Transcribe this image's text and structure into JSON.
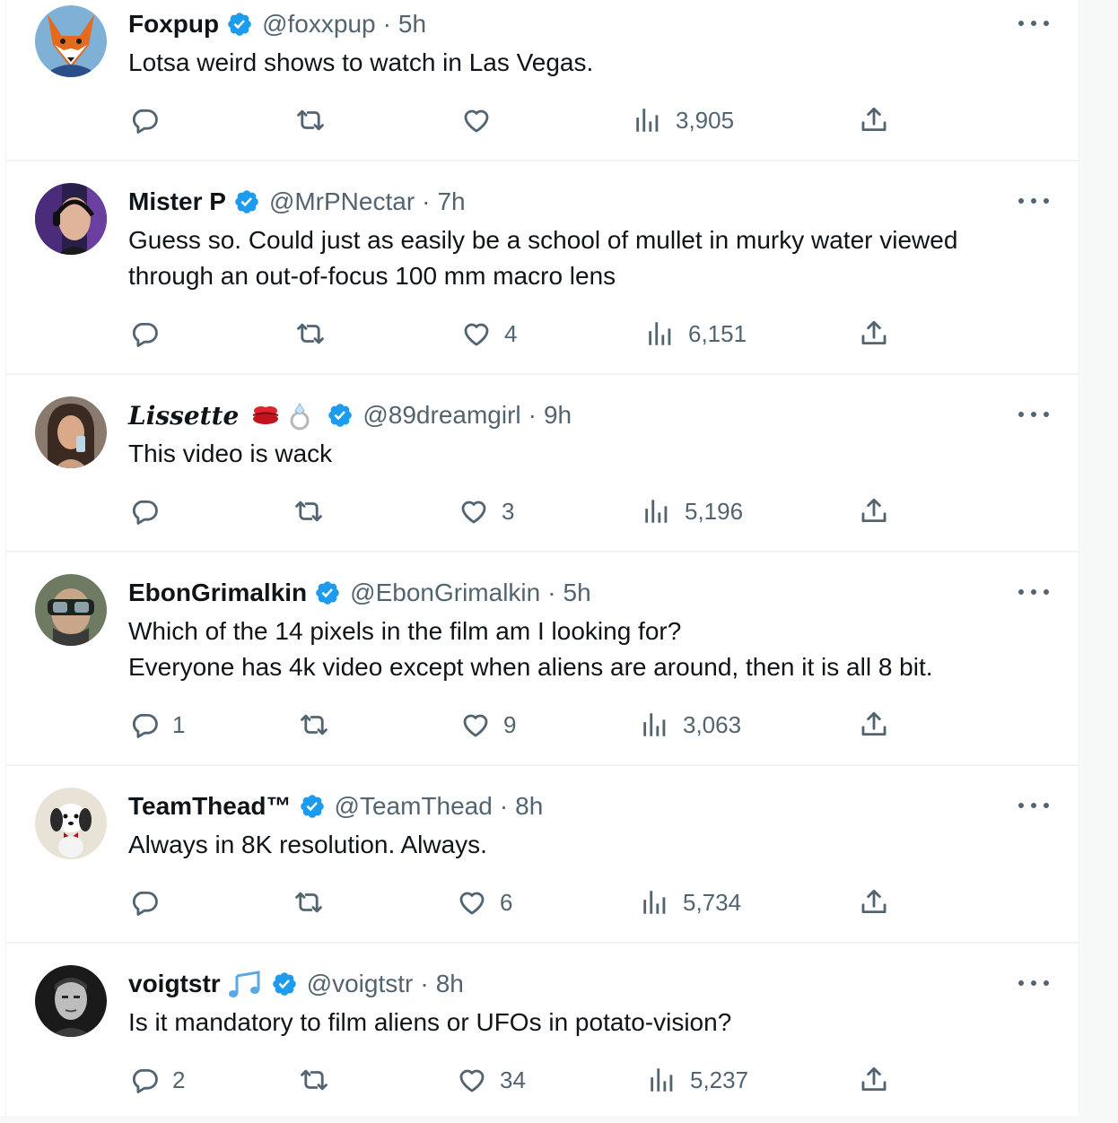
{
  "tweets": [
    {
      "name": "Foxpup",
      "name_emoji": "",
      "avatar": "fox-avatar",
      "verified": true,
      "handle": "@foxxpup",
      "separator": "·",
      "time": "5h",
      "text": [
        "Lotsa weird shows to watch in Las Vegas."
      ],
      "replies": "",
      "retweets": "",
      "likes": "",
      "views": "3,905"
    },
    {
      "name": "Mister P",
      "name_emoji": "",
      "avatar": "headphones-man-avatar",
      "verified": true,
      "handle": "@MrPNectar",
      "separator": "·",
      "time": "7h",
      "text": [
        "Guess so. Could just as easily be a school of mullet in murky water viewed",
        "through an out-of-focus 100 mm macro lens"
      ],
      "replies": "",
      "retweets": "",
      "likes": "4",
      "views": "6,151"
    },
    {
      "name": "Lissette",
      "name_emoji": "💋💍",
      "avatar": "woman-avatar",
      "verified": true,
      "handle": "@89dreamgirl",
      "separator": "·",
      "time": "9h",
      "text": [
        "This video is wack"
      ],
      "replies": "",
      "retweets": "",
      "likes": "3",
      "views": "5,196"
    },
    {
      "name": "EbonGrimalkin",
      "name_emoji": "",
      "avatar": "goggles-man-avatar",
      "verified": true,
      "handle": "@EbonGrimalkin",
      "separator": "·",
      "time": "5h",
      "text": [
        "Which of the 14 pixels in the film am I looking for?",
        "Everyone has 4k video except when aliens are around, then it is all 8 bit."
      ],
      "replies": "1",
      "retweets": "",
      "likes": "9",
      "views": "3,063"
    },
    {
      "name": "TeamThead™",
      "name_emoji": "",
      "avatar": "dog-avatar",
      "verified": true,
      "handle": "@TeamThead",
      "separator": "·",
      "time": "8h",
      "text": [
        "Always in 8K resolution. Always."
      ],
      "replies": "",
      "retweets": "",
      "likes": "6",
      "views": "5,734"
    },
    {
      "name": "voigtstr",
      "name_emoji": "🎶",
      "avatar": "bw-man-avatar",
      "verified": true,
      "handle": "@voigtstr",
      "separator": "·",
      "time": "8h",
      "text": [
        "Is it mandatory to film aliens or UFOs in potato-vision?"
      ],
      "replies": "2",
      "retweets": "",
      "likes": "34",
      "views": "5,237"
    }
  ],
  "icons": {
    "reply": "reply-bubble-icon",
    "retweet": "retweet-arrows-icon",
    "like": "heart-icon",
    "views": "bar-chart-icon",
    "share": "share-upload-icon",
    "more": "more-dots-icon",
    "verified": "verified-badge-icon"
  },
  "colors": {
    "text": "#0f1419",
    "secondary": "#536471",
    "verified": "#1d9bf0",
    "divider": "#eff3f4"
  }
}
